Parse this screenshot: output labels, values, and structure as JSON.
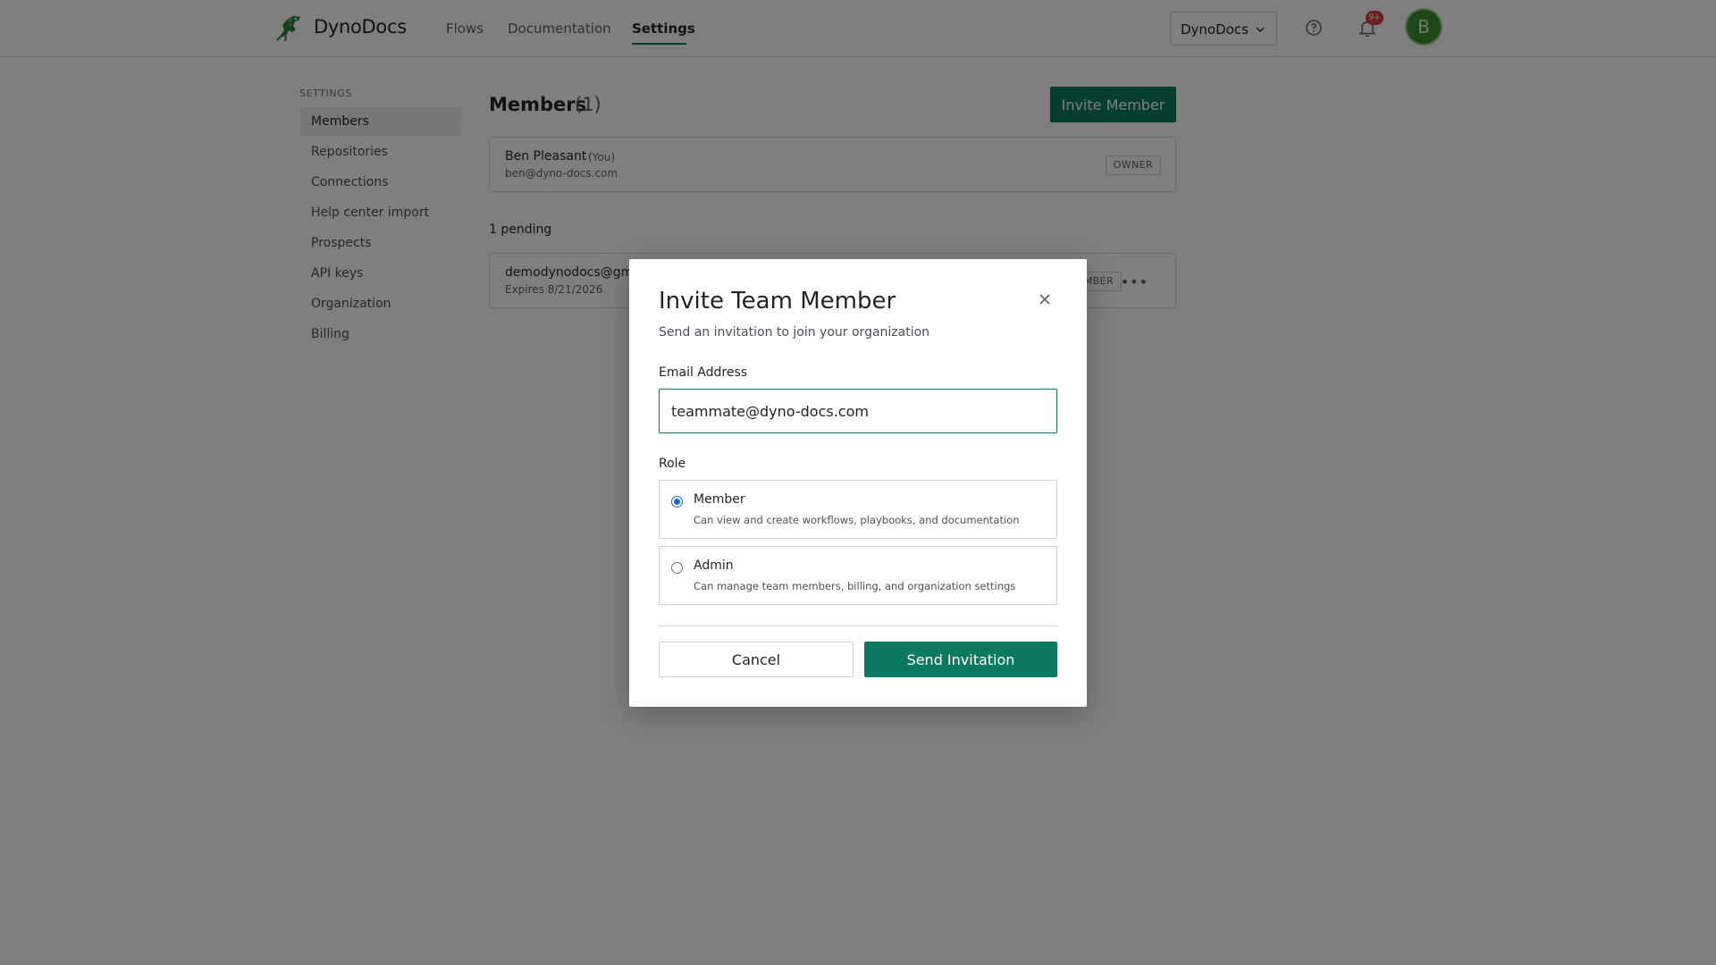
{
  "header": {
    "brand": "DynoDocs",
    "nav": [
      {
        "label": "Flows",
        "active": false
      },
      {
        "label": "Documentation",
        "active": false
      },
      {
        "label": "Settings",
        "active": true
      }
    ],
    "org_selector": "DynoDocs",
    "notification_badge": "9+",
    "avatar_initial": "B",
    "accent_color": "#0b7a60"
  },
  "sidebar": {
    "section_label": "SETTINGS",
    "items": [
      {
        "label": "Members",
        "active": true
      },
      {
        "label": "Repositories",
        "active": false
      },
      {
        "label": "Connections",
        "active": false
      },
      {
        "label": "Help center import",
        "active": false
      },
      {
        "label": "Prospects",
        "active": false
      },
      {
        "label": "API keys",
        "active": false
      },
      {
        "label": "Organization",
        "active": false
      },
      {
        "label": "Billing",
        "active": false
      }
    ]
  },
  "main": {
    "title": "Members",
    "count": "(1)",
    "invite_button": "Invite Member",
    "members": [
      {
        "name": "Ben Pleasant",
        "you_tag": "(You)",
        "email": "ben@dyno-docs.com",
        "role": "OWNER"
      }
    ],
    "pending_label": "1 pending",
    "pending": [
      {
        "email": "demodynodocs@gm",
        "expires": "Expires 8/21/2026",
        "role": "MBER"
      }
    ]
  },
  "modal": {
    "title": "Invite Team Member",
    "subtitle": "Send an invitation to join your organization",
    "email_label": "Email Address",
    "email_value": "teammate@dyno-docs.com",
    "role_label": "Role",
    "roles": [
      {
        "title": "Member",
        "description": "Can view and create workflows, playbooks, and documentation",
        "selected": true
      },
      {
        "title": "Admin",
        "description": "Can manage team members, billing, and organization settings",
        "selected": false
      }
    ],
    "cancel_label": "Cancel",
    "send_label": "Send Invitation"
  }
}
